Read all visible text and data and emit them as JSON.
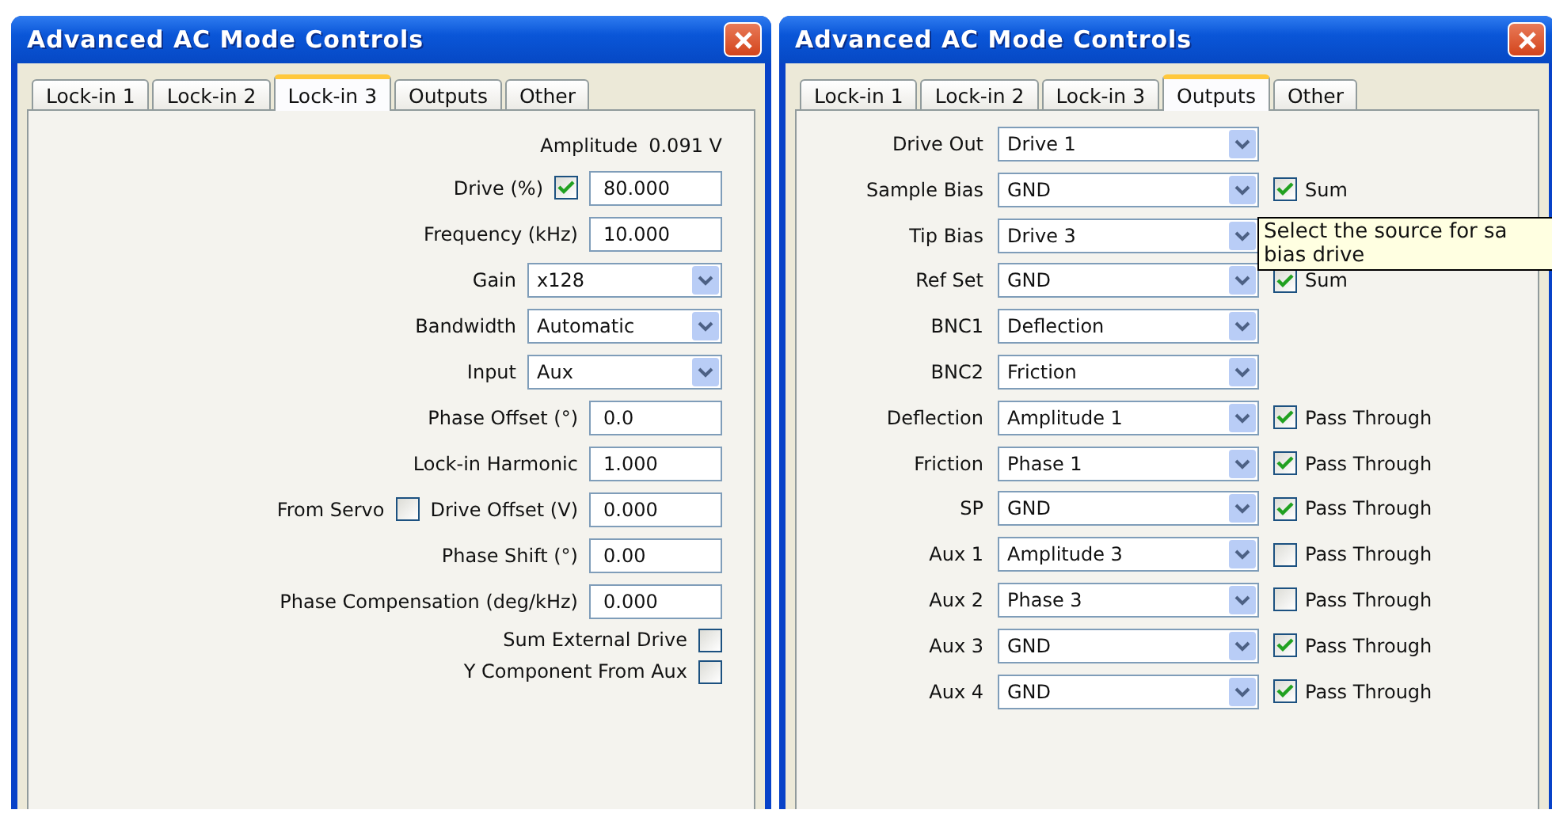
{
  "windows": [
    {
      "title": "Advanced AC Mode Controls",
      "tabs": [
        {
          "label": "Lock-in 1",
          "selected": false
        },
        {
          "label": "Lock-in 2",
          "selected": false
        },
        {
          "label": "Lock-in 3",
          "selected": true
        },
        {
          "label": "Outputs",
          "selected": false
        },
        {
          "label": "Other",
          "selected": false
        }
      ],
      "rows": [
        {
          "kind": "readout",
          "label": "Amplitude",
          "value": "0.091 V"
        },
        {
          "kind": "check-field",
          "label": "Drive (%)",
          "checked": true,
          "value": "80.000"
        },
        {
          "kind": "field",
          "label": "Frequency (kHz)",
          "value": "10.000"
        },
        {
          "kind": "select",
          "label": "Gain",
          "value": "x128"
        },
        {
          "kind": "select",
          "label": "Bandwidth",
          "value": "Automatic"
        },
        {
          "kind": "select",
          "label": "Input",
          "value": "Aux"
        },
        {
          "kind": "field",
          "label": "Phase Offset (°)",
          "value": "0.0"
        },
        {
          "kind": "field",
          "label": "Lock-in Harmonic",
          "value": "1.000"
        },
        {
          "kind": "servo",
          "prefix": "From Servo",
          "checked": false,
          "label": "Drive Offset (V)",
          "value": "0.000"
        },
        {
          "kind": "field",
          "label": "Phase Shift (°)",
          "value": "0.00"
        },
        {
          "kind": "field",
          "label": "Phase Compensation (deg/kHz)",
          "value": "0.000"
        },
        {
          "kind": "checkbox",
          "label": "Sum External Drive",
          "checked": false
        },
        {
          "kind": "checkbox",
          "label": "Y Component From Aux",
          "checked": false
        }
      ]
    },
    {
      "title": "Advanced AC Mode Controls",
      "tabs": [
        {
          "label": "Lock-in 1",
          "selected": false
        },
        {
          "label": "Lock-in 2",
          "selected": false
        },
        {
          "label": "Lock-in 3",
          "selected": false
        },
        {
          "label": "Outputs",
          "selected": true
        },
        {
          "label": "Other",
          "selected": false
        }
      ],
      "outputs": [
        {
          "label": "Drive Out",
          "value": "Drive 1"
        },
        {
          "label": "Sample Bias",
          "value": "GND",
          "option": {
            "label": "Sum",
            "checked": true
          }
        },
        {
          "label": "Tip Bias",
          "value": "Drive 3"
        },
        {
          "label": "Ref Set",
          "value": "GND",
          "option": {
            "label": "Sum",
            "checked": true
          }
        },
        {
          "label": "BNC1",
          "value": "Deflection"
        },
        {
          "label": "BNC2",
          "value": "Friction"
        },
        {
          "label": "Deflection",
          "value": "Amplitude 1",
          "option": {
            "label": "Pass Through",
            "checked": true
          }
        },
        {
          "label": "Friction",
          "value": "Phase 1",
          "option": {
            "label": "Pass Through",
            "checked": true
          }
        },
        {
          "label": "SP",
          "value": "GND",
          "option": {
            "label": "Pass Through",
            "checked": true
          }
        },
        {
          "label": "Aux 1",
          "value": "Amplitude 3",
          "option": {
            "label": "Pass Through",
            "checked": false
          }
        },
        {
          "label": "Aux 2",
          "value": "Phase 3",
          "option": {
            "label": "Pass Through",
            "checked": false
          }
        },
        {
          "label": "Aux 3",
          "value": "GND",
          "option": {
            "label": "Pass Through",
            "checked": true
          }
        },
        {
          "label": "Aux 4",
          "value": "GND",
          "option": {
            "label": "Pass Through",
            "checked": true
          }
        }
      ],
      "tooltip": {
        "lines": [
          "Select the source for sa",
          "bias drive"
        ]
      }
    }
  ]
}
